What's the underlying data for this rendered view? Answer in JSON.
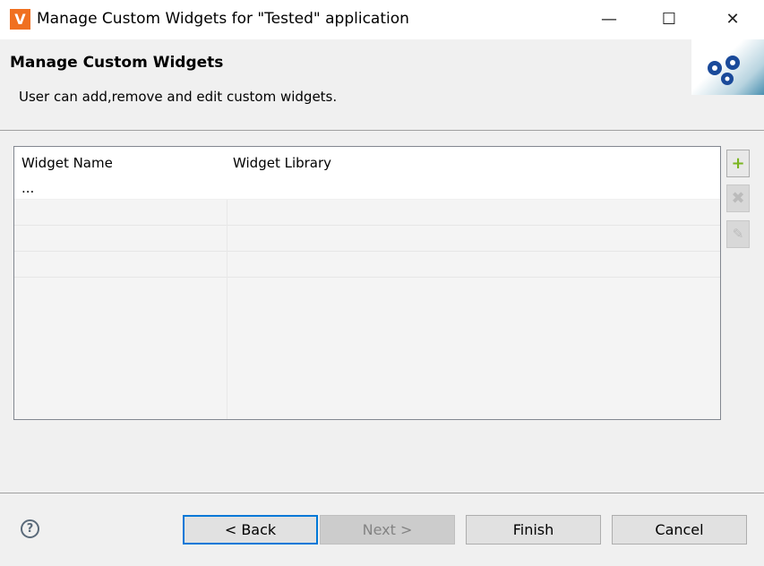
{
  "window": {
    "title": "Manage Custom Widgets for \"Tested\" application",
    "icon": "app-logo-icon"
  },
  "header": {
    "title": "Manage Custom Widgets",
    "description": "User can add,remove and edit custom widgets."
  },
  "table": {
    "columns": [
      "Widget Name",
      "Widget Library"
    ],
    "rows": [
      [
        "...",
        ""
      ]
    ]
  },
  "side_buttons": {
    "add": "add-icon",
    "remove": "remove-icon",
    "edit": "edit-icon"
  },
  "footer": {
    "back": "< Back",
    "next": "Next >",
    "finish": "Finish",
    "cancel": "Cancel",
    "help": "?"
  }
}
